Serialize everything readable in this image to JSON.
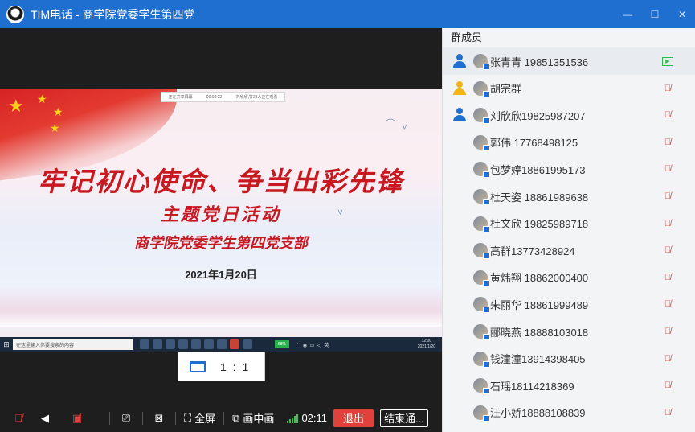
{
  "window": {
    "title": "TIM电话 - 商学院党委学生第四党"
  },
  "slide": {
    "headline": "牢记初心使命、争当出彩先锋",
    "subhead": "主题党日活动",
    "branch": "商学院党委学生第四党支部",
    "date": "2021年1月20日",
    "top_bar_items": [
      "正在共享屏幕",
      "00:04:22",
      "刘欣欣,等28人正在观看"
    ],
    "taskbar_search": "在这里输入你要搜索的内容",
    "taskbar_battery": "58%",
    "taskbar_time": "12:00",
    "taskbar_date": "2021/1/20"
  },
  "ratio": {
    "label": "1 : 1"
  },
  "toolbar": {
    "fullscreen_label": "全屏",
    "pip_label": "画中画",
    "timer": "02:11",
    "leave_label": "退出",
    "end_label": "结束通..."
  },
  "members_panel": {
    "header": "群成员",
    "members": [
      {
        "name": "张青青 19851351536",
        "role": "member",
        "status": "sharing"
      },
      {
        "name": "胡宗群",
        "role": "admin",
        "status": "muted"
      },
      {
        "name": "刘欣欣19825987207",
        "role": "member",
        "status": "muted"
      },
      {
        "name": "郭伟 17768498125",
        "role": "none",
        "status": "muted"
      },
      {
        "name": "包梦婷18861995173",
        "role": "none",
        "status": "muted"
      },
      {
        "name": "杜天姿 18861989638",
        "role": "none",
        "status": "muted"
      },
      {
        "name": "杜文欣 19825989718",
        "role": "none",
        "status": "muted"
      },
      {
        "name": "高群13773428924",
        "role": "none",
        "status": "muted"
      },
      {
        "name": "黄炜翔 18862000400",
        "role": "none",
        "status": "muted"
      },
      {
        "name": "朱丽华 18861999489",
        "role": "none",
        "status": "muted"
      },
      {
        "name": "郦晓燕 18888103018",
        "role": "none",
        "status": "muted"
      },
      {
        "name": "钱潼潼13914398405",
        "role": "none",
        "status": "muted"
      },
      {
        "name": "石瑶18114218369",
        "role": "none",
        "status": "muted"
      },
      {
        "name": "汪小娇18888108839",
        "role": "none",
        "status": "muted"
      }
    ]
  },
  "colors": {
    "titlebar": "#1f6fd1",
    "leave": "#e0413a",
    "slide_text": "#c81820",
    "member_role": "#1f6fd1",
    "admin_role": "#f2b418"
  }
}
